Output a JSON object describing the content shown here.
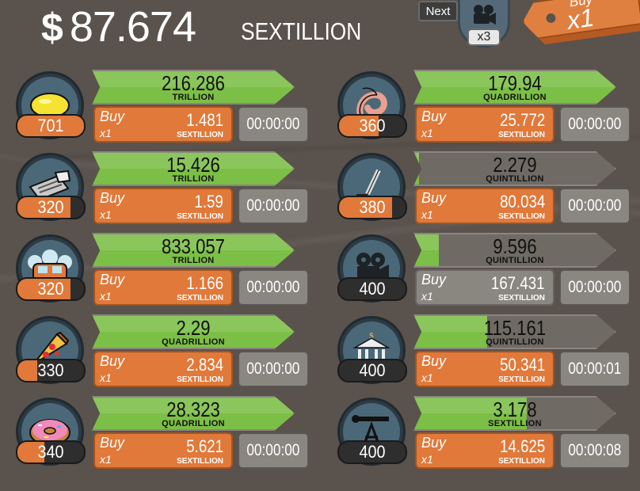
{
  "header": {
    "money_symbol": "$",
    "money_value": "87.674",
    "money_unit": "SEXTILLION",
    "next_label": "Next",
    "manager_count": "x3",
    "buy_label": "Buy",
    "buy_multiplier": "x1"
  },
  "colors": {
    "progress_green": "#7cbf46",
    "buy_orange": "#e0793a",
    "icon_ring": "#2d3a44",
    "background": "#5a524c"
  },
  "businesses": [
    {
      "icon": "lemon-icon",
      "count": "701",
      "count_progress": 1.0,
      "revenue_value": "216.286",
      "revenue_unit": "TRILLION",
      "revenue_progress": 1.0,
      "buy_label": "Buy",
      "buy_multiplier": "x1",
      "cost_value": "1.481",
      "cost_unit": "SEXTILLION",
      "timer": "00:00:00",
      "affordable": true
    },
    {
      "icon": "newspaper-icon",
      "count": "320",
      "count_progress": 0.8,
      "revenue_value": "15.426",
      "revenue_unit": "TRILLION",
      "revenue_progress": 1.0,
      "buy_label": "Buy",
      "buy_multiplier": "x1",
      "cost_value": "1.59",
      "cost_unit": "SEXTILLION",
      "timer": "00:00:00",
      "affordable": true
    },
    {
      "icon": "car-wash-icon",
      "count": "320",
      "count_progress": 0.8,
      "revenue_value": "833.057",
      "revenue_unit": "TRILLION",
      "revenue_progress": 1.0,
      "buy_label": "Buy",
      "buy_multiplier": "x1",
      "cost_value": "1.166",
      "cost_unit": "SEXTILLION",
      "timer": "00:00:00",
      "affordable": true
    },
    {
      "icon": "pizza-icon",
      "count": "330",
      "count_progress": 0.3,
      "revenue_value": "2.29",
      "revenue_unit": "QUADRILLION",
      "revenue_progress": 1.0,
      "buy_label": "Buy",
      "buy_multiplier": "x1",
      "cost_value": "2.834",
      "cost_unit": "SEXTILLION",
      "timer": "00:00:00",
      "affordable": true
    },
    {
      "icon": "donut-icon",
      "count": "340",
      "count_progress": 0.4,
      "revenue_value": "28.323",
      "revenue_unit": "QUADRILLION",
      "revenue_progress": 1.0,
      "buy_label": "Buy",
      "buy_multiplier": "x1",
      "cost_value": "5.621",
      "cost_unit": "SEXTILLION",
      "timer": "00:00:00",
      "affordable": true
    },
    {
      "icon": "shrimp-icon",
      "count": "360",
      "count_progress": 0.6,
      "revenue_value": "179.94",
      "revenue_unit": "QUADRILLION",
      "revenue_progress": 1.0,
      "buy_label": "Buy",
      "buy_multiplier": "x1",
      "cost_value": "25.772",
      "cost_unit": "SEXTILLION",
      "timer": "00:00:00",
      "affordable": true
    },
    {
      "icon": "hockey-icon",
      "count": "380",
      "count_progress": 0.8,
      "revenue_value": "2.279",
      "revenue_unit": "QUINTILLION",
      "revenue_progress": 0.02,
      "buy_label": "Buy",
      "buy_multiplier": "x1",
      "cost_value": "80.034",
      "cost_unit": "SEXTILLION",
      "timer": "00:00:00",
      "affordable": true
    },
    {
      "icon": "movie-camera-icon",
      "count": "400",
      "count_progress": 0.0,
      "revenue_value": "9.596",
      "revenue_unit": "QUINTILLION",
      "revenue_progress": 0.12,
      "buy_label": "Buy",
      "buy_multiplier": "x1",
      "cost_value": "167.431",
      "cost_unit": "SEXTILLION",
      "timer": "00:00:00",
      "affordable": false
    },
    {
      "icon": "bank-icon",
      "count": "400",
      "count_progress": 0.0,
      "revenue_value": "115.161",
      "revenue_unit": "QUINTILLION",
      "revenue_progress": 0.36,
      "buy_label": "Buy",
      "buy_multiplier": "x1",
      "cost_value": "50.341",
      "cost_unit": "SEXTILLION",
      "timer": "00:00:01",
      "affordable": true
    },
    {
      "icon": "oil-rig-icon",
      "count": "400",
      "count_progress": 0.0,
      "revenue_value": "3.178",
      "revenue_unit": "SEXTILLION",
      "revenue_progress": 0.56,
      "buy_label": "Buy",
      "buy_multiplier": "x1",
      "cost_value": "14.625",
      "cost_unit": "SEXTILLION",
      "timer": "00:00:08",
      "affordable": true
    }
  ]
}
